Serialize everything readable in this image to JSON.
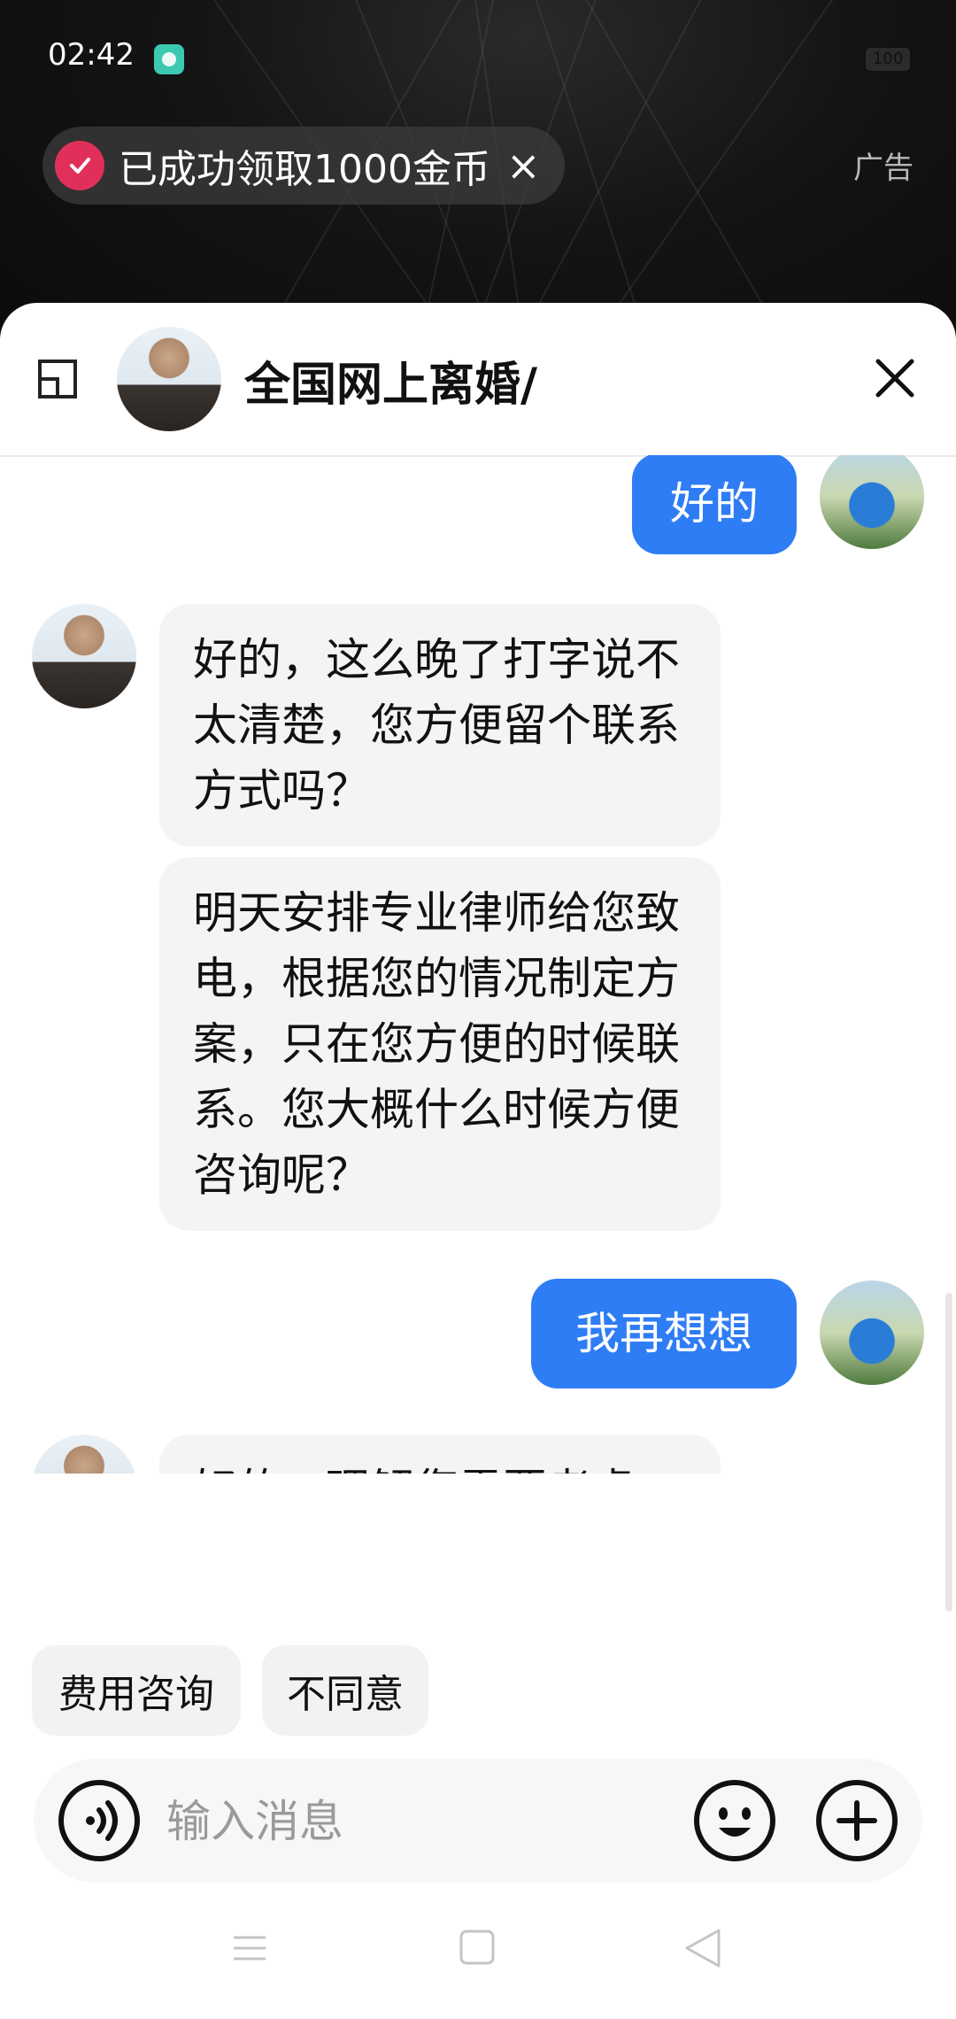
{
  "status_bar": {
    "time": "02:42",
    "battery": "100"
  },
  "ad_overlay": {
    "reward_text": "已成功领取1000金币",
    "close_glyph": "×",
    "ad_label": "广告"
  },
  "chat": {
    "title": "全国网上离婚/",
    "messages": [
      {
        "sender": "user",
        "text": "好的"
      },
      {
        "sender": "lawyer",
        "text": "好的，这么晚了打字说不太清楚，您方便留个联系方式吗？"
      },
      {
        "sender": "lawyer",
        "text": "明天安排专业律师给您致电，根据您的情况制定方案，只在您方便的时候联系。您大概什么时候方便咨询呢？"
      },
      {
        "sender": "user",
        "text": "我再想想"
      },
      {
        "sender": "lawyer",
        "text": "好的，理解您需要考虑一下"
      }
    ],
    "quick_replies": [
      "费用咨询",
      "不同意"
    ],
    "input": {
      "placeholder": "输入消息",
      "value": ""
    }
  },
  "colors": {
    "user_bubble": "#2f7df5",
    "lawyer_bubble": "#f4f4f6",
    "reward_check": "#e0305a"
  },
  "icons": [
    "collapse-icon",
    "close-icon",
    "voice-icon",
    "emoji-icon",
    "plus-icon",
    "nav-menu-icon",
    "nav-home-icon",
    "nav-back-icon"
  ]
}
